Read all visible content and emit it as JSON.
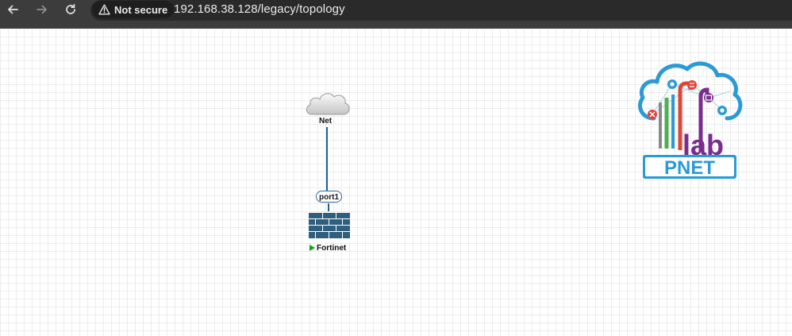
{
  "browser": {
    "back_icon": "arrow-left-icon",
    "forward_icon": "arrow-right-icon",
    "reload_icon": "reload-icon",
    "security_icon": "warning-triangle-icon",
    "security_label": "Not secure",
    "url": "192.168.38.128/legacy/topology"
  },
  "topology": {
    "nodes": [
      {
        "label": "Net",
        "icon": "cloud-icon"
      },
      {
        "label": "Fortinet",
        "icon": "firewall-icon",
        "status": "running"
      }
    ],
    "link": {
      "port_label": "port1",
      "color": "#1f5fa0"
    }
  },
  "logo": {
    "text": "PNET",
    "lab_text": "lab",
    "colors": {
      "blue": "#2b9ad6",
      "green": "#4caf50",
      "red": "#e0453a",
      "purple": "#7b2d8e",
      "gray": "#8a8a8a"
    }
  }
}
